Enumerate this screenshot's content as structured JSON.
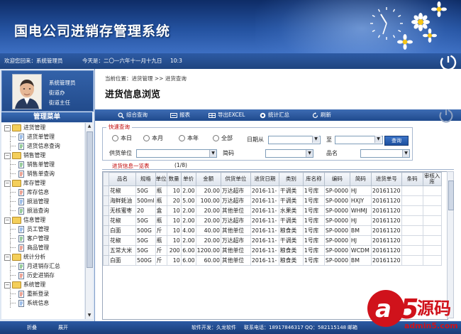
{
  "header": {
    "title": "国电公司进销存管理系统"
  },
  "status": {
    "welcome": "欢迎您回来：系统管理员",
    "today": "今天是：二〇一六年十一月十九日",
    "time": "10:3"
  },
  "user": {
    "role": "系统管理员",
    "line2": "街道办",
    "line3": "街道主任"
  },
  "menu": {
    "title": "管理菜单",
    "groups": [
      {
        "label": "进货管理",
        "items": [
          "进货单管理",
          "进货信息查询"
        ]
      },
      {
        "label": "销售管理",
        "items": [
          "销售单管理",
          "销售单查询"
        ]
      },
      {
        "label": "库存管理",
        "items": [
          "库存信息",
          "损溢管理",
          "损溢查询"
        ]
      },
      {
        "label": "信息管理",
        "items": [
          "员工管理",
          "客户管理",
          "商品管理"
        ]
      },
      {
        "label": "统计分析",
        "items": [
          "月进销存汇总",
          "历史进销存"
        ]
      },
      {
        "label": "系统管理",
        "items": [
          "重新登录",
          "系统信息"
        ]
      }
    ]
  },
  "content": {
    "breadcrumb": "当前位置：进货管理 >> 进货查询",
    "page_title": "进货信息浏览",
    "toolbar": {
      "overview": "综合查询",
      "report": "报表",
      "export": "导出EXCEL",
      "stats": "统计汇总",
      "refresh": "刷新"
    },
    "quick": {
      "legend": "快速查询",
      "radio_today": "本日",
      "radio_month": "本月",
      "radio_year": "本年",
      "radio_all": "全部",
      "date_from_label": "日期从",
      "date_to_label": "至",
      "query_btn": "查询",
      "supplier_label": "供货单位",
      "code_label": "简码",
      "name_label": "品名"
    },
    "list_title": "进货信息一览表",
    "page_count": "(1/8)",
    "table": {
      "headers": [
        "品名",
        "规格",
        "单位",
        "数量",
        "单价",
        "金额",
        "供货单位",
        "进货日期",
        "类别",
        "库名称",
        "编码",
        "简码",
        "进货单号",
        "条码",
        "审核入库"
      ],
      "rows": [
        [
          "花椒",
          "50G",
          "瓶",
          "10",
          "2.00",
          "20.00",
          "万达超市",
          "2016-11-",
          "干调类",
          "1号库",
          "SP-0000",
          "HJ",
          "20161120",
          "",
          ""
        ],
        [
          "海鲜蚝油",
          "500ml",
          "瓶",
          "20",
          "5.00",
          "100.00",
          "万达超市",
          "2016-11-",
          "干调类",
          "1号库",
          "SP-0000",
          "HXJY",
          "20161120",
          "",
          ""
        ],
        [
          "无核蜜枣",
          "20",
          "盒",
          "10",
          "2.00",
          "20.00",
          "其他单位",
          "2016-11-",
          "水果类",
          "1号库",
          "SP-0000",
          "WHMJ",
          "20161120",
          "",
          ""
        ],
        [
          "花椒",
          "50G",
          "瓶",
          "10",
          "2.00",
          "20.00",
          "万达超市",
          "2016-11-",
          "干调类",
          "1号库",
          "SP-0000",
          "HJ",
          "20161120",
          "",
          ""
        ],
        [
          "白面",
          "500G",
          "斤",
          "10",
          "4.00",
          "40.00",
          "其他单位",
          "2016-11-",
          "粮食类",
          "1号库",
          "SP-0000",
          "BM",
          "20161120",
          "",
          ""
        ],
        [
          "花椒",
          "50G",
          "瓶",
          "10",
          "2.00",
          "20.00",
          "万达超市",
          "2016-11-",
          "干调类",
          "1号库",
          "SP-0000",
          "HJ",
          "20161120",
          "",
          ""
        ],
        [
          "五常大米",
          "50G",
          "斤",
          "200",
          "6.00",
          "1200.00",
          "其他单位",
          "2016-11-",
          "粮食类",
          "1号库",
          "SP-0000",
          "WCDM",
          "20161120",
          "",
          ""
        ],
        [
          "白面",
          "500G",
          "斤",
          "10",
          "6.00",
          "60.00",
          "其他单位",
          "2016-11-",
          "粮食类",
          "1号库",
          "SP-0000",
          "BM",
          "20161120",
          "",
          ""
        ]
      ]
    }
  },
  "footer": {
    "collapse": "折叠",
    "expand": "展开",
    "developer": "软件开发：久龙软件",
    "phone": "联系电话：18917846317",
    "qq": "QQ：582115148",
    "email": "邮箱"
  },
  "watermark": {
    "brand": "源码",
    "domain": "admin5.com"
  },
  "colors": {
    "header_dark": "#0e2c66",
    "accent_blue": "#2452a0",
    "legend_red": "#c00000",
    "watermark_red": "#d0121b"
  }
}
